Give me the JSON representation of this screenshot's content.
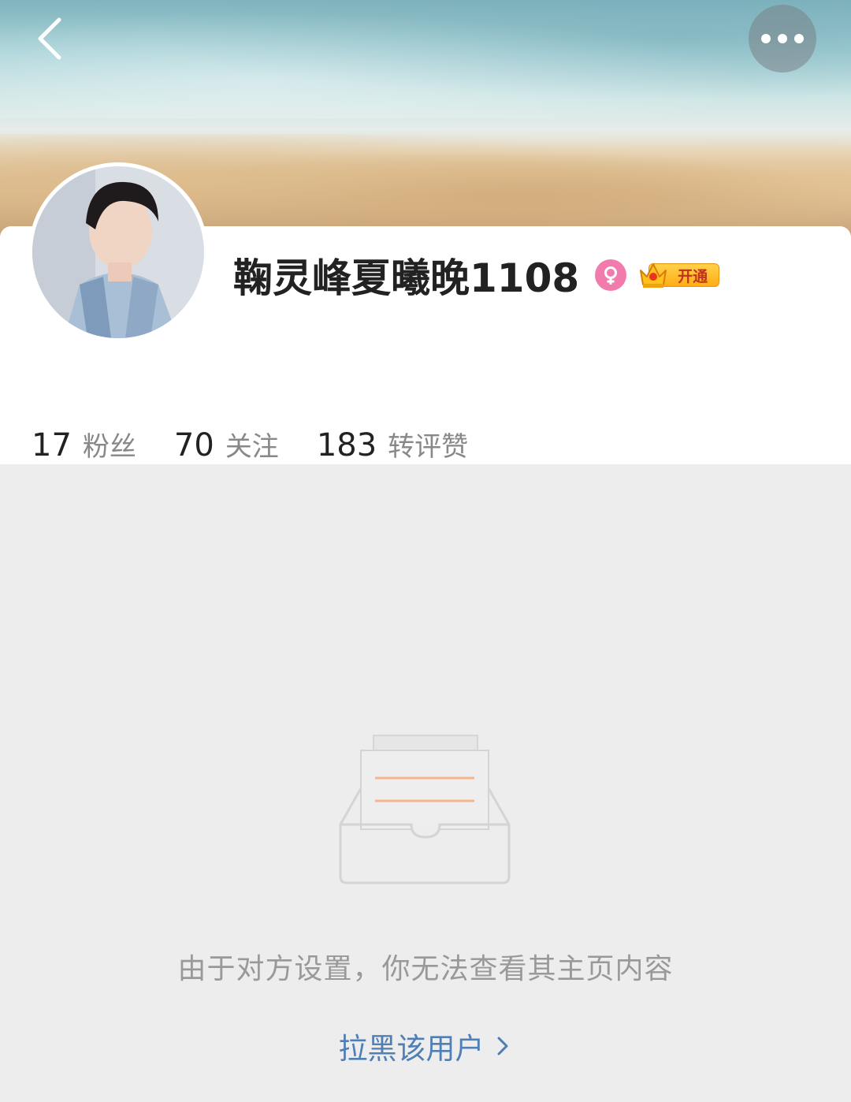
{
  "header": {
    "back_icon": "chevron-left-icon",
    "more_icon": "more-horizontal-icon"
  },
  "profile": {
    "username": "鞠灵峰夏曦晚1108",
    "gender": "female",
    "gender_color": "#f27bae",
    "vip_label": "开通",
    "vip_icon": "crown-icon"
  },
  "stats": [
    {
      "value": "17",
      "label": "粉丝"
    },
    {
      "value": "70",
      "label": "关注"
    },
    {
      "value": "183",
      "label": "转评赞"
    }
  ],
  "empty_state": {
    "icon": "empty-inbox-icon",
    "message": "由于对方设置，你无法查看其主页内容",
    "action_label": "拉黑该用户"
  },
  "colors": {
    "link": "#4f7fb5",
    "muted_text": "#999999",
    "background": "#ededed"
  }
}
